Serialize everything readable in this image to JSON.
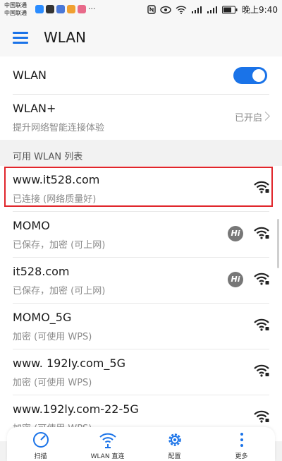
{
  "status_bar": {
    "carrier_1": "中国联通",
    "carrier_2": "中国联通",
    "time": "晚上9:40",
    "battery_icon": "battery-icon",
    "signal_icon": "signal-icon"
  },
  "app_bar": {
    "title": "WLAN",
    "menu_icon": "hamburger-icon"
  },
  "wlan_toggle": {
    "label": "WLAN",
    "enabled": true
  },
  "wlan_plus": {
    "title": "WLAN+",
    "subtitle": "提升网络智能连接体验",
    "status": "已开启"
  },
  "section_label": "可用 WLAN 列表",
  "networks": [
    {
      "ssid": "www.it528.com",
      "status": "已连接 (网络质量好)",
      "hi": false
    },
    {
      "ssid": "MOMO",
      "status": "已保存，加密 (可上网)",
      "hi": true
    },
    {
      "ssid": "it528.com",
      "status": "已保存，加密 (可上网)",
      "hi": true
    },
    {
      "ssid": "MOMO_5G",
      "status": "加密 (可使用 WPS)",
      "hi": false
    },
    {
      "ssid": "www. 192ly.com_5G",
      "status": "加密 (可使用 WPS)",
      "hi": false
    },
    {
      "ssid": "www.192ly.com-22-5G",
      "status": "加密 (可使用 WPS)",
      "hi": false
    }
  ],
  "hi_badge": "Hi",
  "bottom_tabs": [
    {
      "label": "扫描",
      "icon": "scan-icon"
    },
    {
      "label": "WLAN 直连",
      "icon": "wlan-direct-icon"
    },
    {
      "label": "配置",
      "icon": "settings-icon"
    },
    {
      "label": "更多",
      "icon": "more-icon"
    }
  ],
  "colors": {
    "accent": "#1a73e8",
    "highlight": "#e0262b"
  }
}
